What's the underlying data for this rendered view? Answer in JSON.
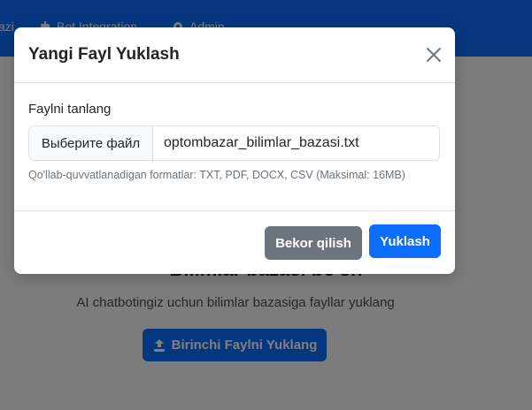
{
  "background": {
    "navbar": {
      "link_partial": "azi",
      "link_bots": "Bot Integration",
      "link_admin": "Admin"
    },
    "empty_state": {
      "title": "Bilimlar bazasi bo'sh",
      "subtitle": "AI chatbotingiz uchun bilimlar bazasiga fayllar yuklang",
      "button_label": "Birinchi Faylni Yuklang"
    }
  },
  "modal": {
    "title": "Yangi Fayl Yuklash",
    "field_label": "Faylni tanlang",
    "file_button_label": "Выберите файл",
    "file_name": "optombazar_bilimlar_bazasi.txt",
    "help_text": "Qo'llab-quvvatlanadigan formatlar: TXT, PDF, DOCX, CSV (Maksimal: 16MB)",
    "cancel_label": "Bekor qilish",
    "upload_label": "Yuklash"
  },
  "colors": {
    "primary": "#0d6efd",
    "secondary": "#6c757d"
  }
}
